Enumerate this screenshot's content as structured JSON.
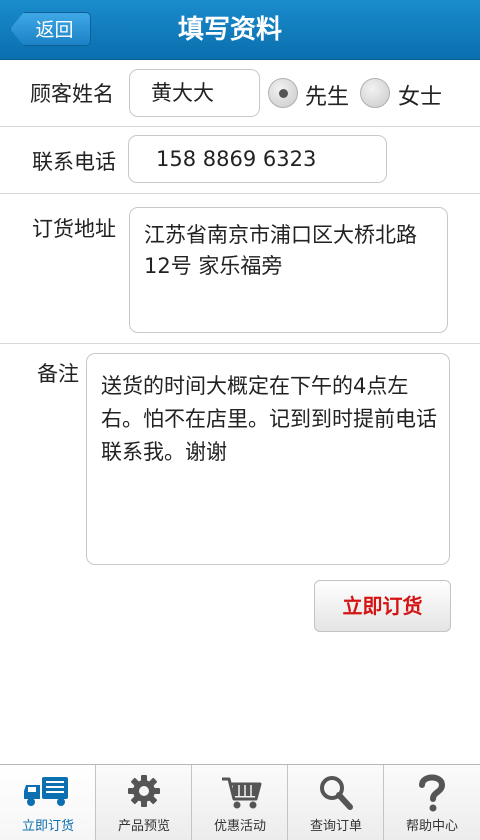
{
  "header": {
    "back_label": "返回",
    "title": "填写资料"
  },
  "form": {
    "name_label": "顾客姓名",
    "name_value": "黄大大",
    "gender_options": [
      "先生",
      "女士"
    ],
    "gender_selected": "先生",
    "phone_label": "联系电话",
    "phone_value": "158 8869 6323",
    "address_label": "订货地址",
    "address_value": "江苏省南京市浦口区大桥北路12号 家乐福旁",
    "note_label": "备注",
    "note_value": "送货的时间大概定在下午的4点左右。怕不在店里。记到到时提前电话联系我。谢谢",
    "submit_label": "立即订货"
  },
  "tabs": [
    {
      "label": "立即订货",
      "icon": "truck-icon",
      "active": true
    },
    {
      "label": "产品预览",
      "icon": "gear-icon",
      "active": false
    },
    {
      "label": "优惠活动",
      "icon": "cart-icon",
      "active": false
    },
    {
      "label": "查询订单",
      "icon": "search-icon",
      "active": false
    },
    {
      "label": "帮助中心",
      "icon": "help-icon",
      "active": false
    }
  ],
  "colors": {
    "header": "#0a6fae",
    "accent": "#d51313",
    "active_tab": "#0b6fb0"
  }
}
